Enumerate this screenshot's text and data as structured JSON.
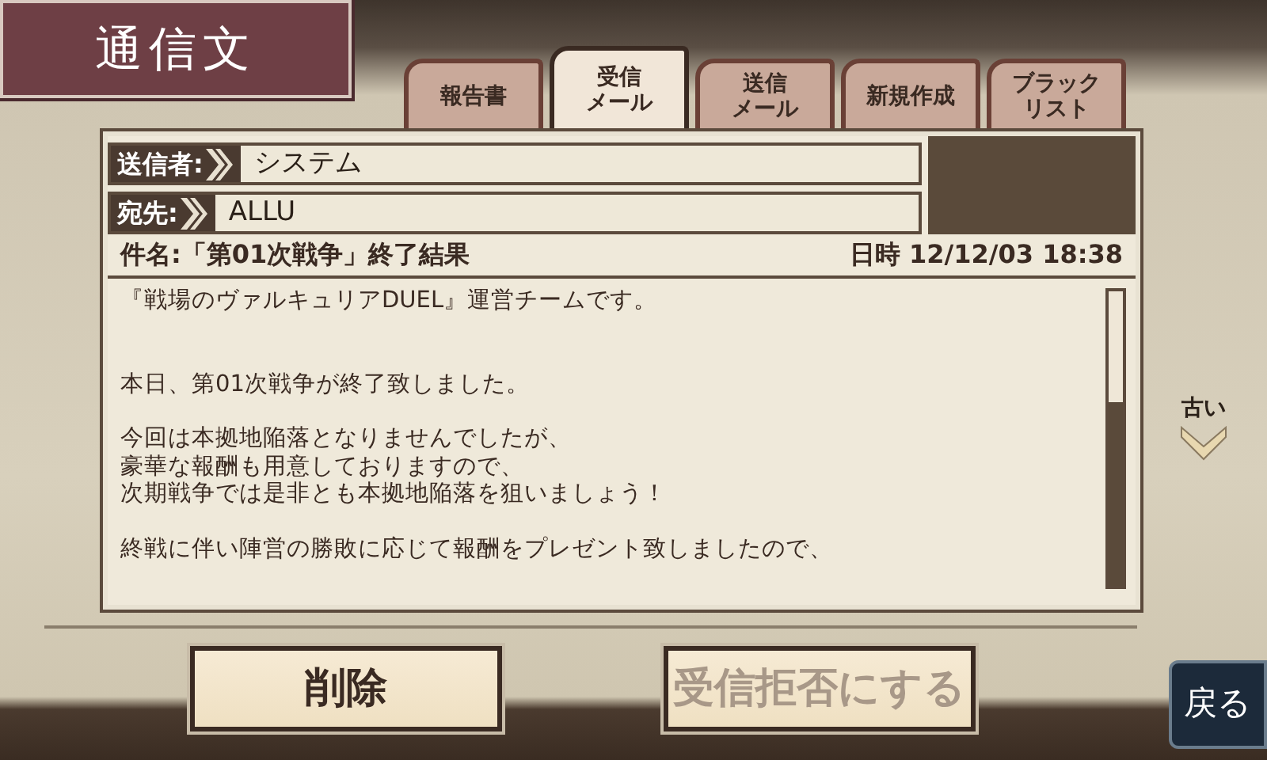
{
  "title": "通信文",
  "tabs": [
    {
      "lines": [
        "報告書"
      ],
      "selected": false
    },
    {
      "lines": [
        "受信",
        "メール"
      ],
      "selected": true
    },
    {
      "lines": [
        "送信",
        "メール"
      ],
      "selected": false
    },
    {
      "lines": [
        "新規作成"
      ],
      "selected": false
    },
    {
      "lines": [
        "ブラック",
        "リスト"
      ],
      "selected": false
    }
  ],
  "sender": {
    "label": "送信者:",
    "value": "システム"
  },
  "recipient": {
    "label": "宛先:",
    "value": "ALLU"
  },
  "subject": {
    "label": "件名:",
    "value": "「第01次戦争」終了結果"
  },
  "date": {
    "label": "日時",
    "value": "12/12/03 18:38"
  },
  "body": [
    [
      "『戦場のヴァルキュリアDUEL』運営チームです。"
    ],
    [
      "本日、第01次戦争が終了致しました。"
    ],
    [
      "今回は本拠地陥落となりませんでしたが、",
      "豪華な報酬も用意しておりますので、",
      "次期戦争では是非とも本拠地陥落を狙いましょう！"
    ],
    [
      "終戦に伴い陣営の勝敗に応じて報酬をプレゼント致しましたので、"
    ]
  ],
  "older": {
    "label": "古い"
  },
  "buttons": [
    {
      "label": "削除",
      "disabled": false
    },
    {
      "label": "受信拒否にする",
      "disabled": true
    }
  ],
  "back": {
    "label": "戻る"
  }
}
